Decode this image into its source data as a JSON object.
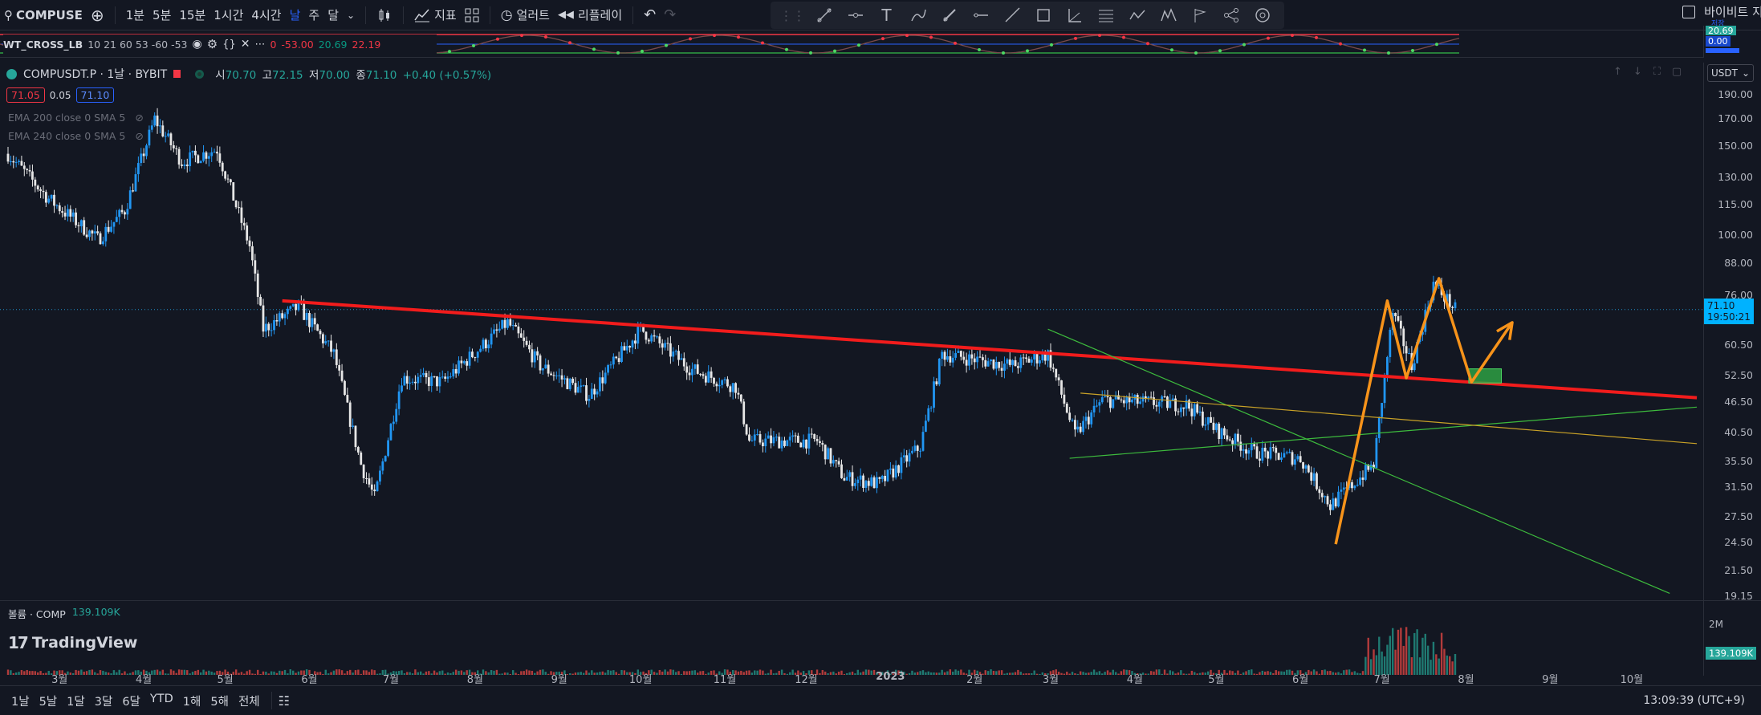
{
  "toolbar": {
    "symbol": "COMPUSE",
    "intervals": [
      "1분",
      "5분",
      "15분",
      "1시간",
      "4시간",
      "날",
      "주",
      "달"
    ],
    "active_interval": "날",
    "indicators_label": "지표",
    "alert_label": "얼러트",
    "replay_label": "리플레이",
    "account_label": "바이비트 지",
    "account_sub": "저장"
  },
  "indicator_strip": {
    "name": "WT_CROSS_LB",
    "params": "10 21 60 53 -60 -53",
    "values": [
      "0",
      "-53.00",
      "20.69",
      "22.19"
    ],
    "value_colors": [
      "#f23645",
      "#f23645",
      "#089981",
      "#f23645"
    ],
    "axis_values": [
      "20.69",
      "0.00"
    ]
  },
  "legend": {
    "symbol": "COMPUSDT.P · 1날 · BYBIT",
    "open_label": "시",
    "open": "70.70",
    "high_label": "고",
    "high": "72.15",
    "low_label": "저",
    "low": "70.00",
    "close_label": "종",
    "close": "71.10",
    "change": "+0.40 (+0.57%)",
    "bid": "71.05",
    "spread": "0.05",
    "ask": "71.10",
    "ema1": "EMA 200 close 0 SMA 5",
    "ema2": "EMA 240 close 0 SMA 5"
  },
  "price_axis": {
    "currency": "USDT",
    "ticks": [
      "190.00",
      "170.00",
      "150.00",
      "130.00",
      "115.00",
      "100.00",
      "88.00",
      "76.00",
      "60.50",
      "52.50",
      "46.50",
      "40.50",
      "35.50",
      "31.50",
      "27.50",
      "24.50",
      "21.50",
      "19.15"
    ],
    "last_price": "71.10",
    "countdown": "19:50:21"
  },
  "time_axis": {
    "ticks": [
      "3월",
      "4월",
      "5월",
      "6월",
      "7월",
      "8월",
      "9월",
      "10월",
      "11월",
      "12월",
      "2023",
      "2월",
      "3월",
      "4월",
      "5월",
      "6월",
      "7월",
      "8월",
      "9월",
      "10월"
    ]
  },
  "volume": {
    "label": "볼륨 · COMP",
    "value": "139.109K",
    "axis_tick": "2M",
    "axis_value": "139.109K"
  },
  "watermark": "TradingView",
  "bottom_bar": {
    "ranges": [
      "1날",
      "5날",
      "1달",
      "3달",
      "6달",
      "YTD",
      "1해",
      "5해",
      "전체"
    ],
    "clock": "13:09:39 (UTC+9)"
  },
  "colors": {
    "up": "#26a69a",
    "down": "#ef5350",
    "candle_up": "#2196f3",
    "candle_down": "#e6e6e6",
    "trend_red": "#f21c1c",
    "orange": "#f7931a",
    "green_line": "#3dbb3d",
    "yellow_line": "#c9a227"
  },
  "chart_data": {
    "type": "candlestick",
    "ylim": [
      19.15,
      190
    ],
    "y_scale": "log",
    "start_date": "2022-02-10",
    "end_date": "2023-07-28",
    "anchors": [
      {
        "date": "2022-02-10",
        "price": 145
      },
      {
        "date": "2022-02-25",
        "price": 118
      },
      {
        "date": "2022-03-15",
        "price": 98
      },
      {
        "date": "2022-03-25",
        "price": 112
      },
      {
        "date": "2022-04-05",
        "price": 170
      },
      {
        "date": "2022-04-15",
        "price": 140
      },
      {
        "date": "2022-04-28",
        "price": 148
      },
      {
        "date": "2022-05-10",
        "price": 95
      },
      {
        "date": "2022-05-15",
        "price": 65
      },
      {
        "date": "2022-05-28",
        "price": 72
      },
      {
        "date": "2022-06-10",
        "price": 58
      },
      {
        "date": "2022-06-20",
        "price": 35
      },
      {
        "date": "2022-06-25",
        "price": 30
      },
      {
        "date": "2022-07-05",
        "price": 52
      },
      {
        "date": "2022-07-20",
        "price": 51
      },
      {
        "date": "2022-08-13",
        "price": 67
      },
      {
        "date": "2022-08-25",
        "price": 55
      },
      {
        "date": "2022-09-12",
        "price": 48
      },
      {
        "date": "2022-10-01",
        "price": 65
      },
      {
        "date": "2022-10-20",
        "price": 54
      },
      {
        "date": "2022-11-05",
        "price": 50
      },
      {
        "date": "2022-11-10",
        "price": 39
      },
      {
        "date": "2022-12-05",
        "price": 39
      },
      {
        "date": "2022-12-15",
        "price": 33
      },
      {
        "date": "2022-12-28",
        "price": 32
      },
      {
        "date": "2023-01-12",
        "price": 38
      },
      {
        "date": "2023-01-20",
        "price": 58
      },
      {
        "date": "2023-02-15",
        "price": 55
      },
      {
        "date": "2023-02-28",
        "price": 58
      },
      {
        "date": "2023-03-10",
        "price": 40
      },
      {
        "date": "2023-03-20",
        "price": 47
      },
      {
        "date": "2023-04-20",
        "price": 46
      },
      {
        "date": "2023-05-01",
        "price": 41
      },
      {
        "date": "2023-05-15",
        "price": 37
      },
      {
        "date": "2023-06-01",
        "price": 36
      },
      {
        "date": "2023-06-12",
        "price": 29
      },
      {
        "date": "2023-06-28",
        "price": 35
      },
      {
        "date": "2023-07-05",
        "price": 70
      },
      {
        "date": "2023-07-12",
        "price": 55
      },
      {
        "date": "2023-07-20",
        "price": 80
      },
      {
        "date": "2023-07-28",
        "price": 71.1
      }
    ],
    "trendlines": [
      {
        "name": "red-trendline",
        "from": {
          "date": "2022-05-22",
          "price": 74
        },
        "to": {
          "date": "2023-10-25",
          "price": 47.5
        },
        "color": "#f21c1c"
      },
      {
        "name": "green-desc-line",
        "from": {
          "date": "2023-02-28",
          "price": 65
        },
        "to": {
          "date": "2023-10-15",
          "price": 19.4
        },
        "color": "#3dbb3d"
      },
      {
        "name": "green-asc-line",
        "from": {
          "date": "2023-03-08",
          "price": 36
        },
        "to": {
          "date": "2023-10-25",
          "price": 45.5
        },
        "color": "#3dbb3d"
      },
      {
        "name": "yellow-line",
        "from": {
          "date": "2023-03-12",
          "price": 48.5
        },
        "to": {
          "date": "2023-10-25",
          "price": 38.5
        },
        "color": "#c9a227"
      }
    ],
    "orange_path": [
      {
        "date": "2023-06-14",
        "price": 24.3
      },
      {
        "date": "2023-07-03",
        "price": 74
      },
      {
        "date": "2023-07-10",
        "price": 52
      },
      {
        "date": "2023-07-22",
        "price": 82
      },
      {
        "date": "2023-08-03",
        "price": 51
      },
      {
        "date": "2023-08-18",
        "price": 67
      }
    ],
    "target_box": {
      "date_from": "2023-08-02",
      "date_to": "2023-08-14",
      "price_from": 50.8,
      "price_to": 54.2
    }
  }
}
